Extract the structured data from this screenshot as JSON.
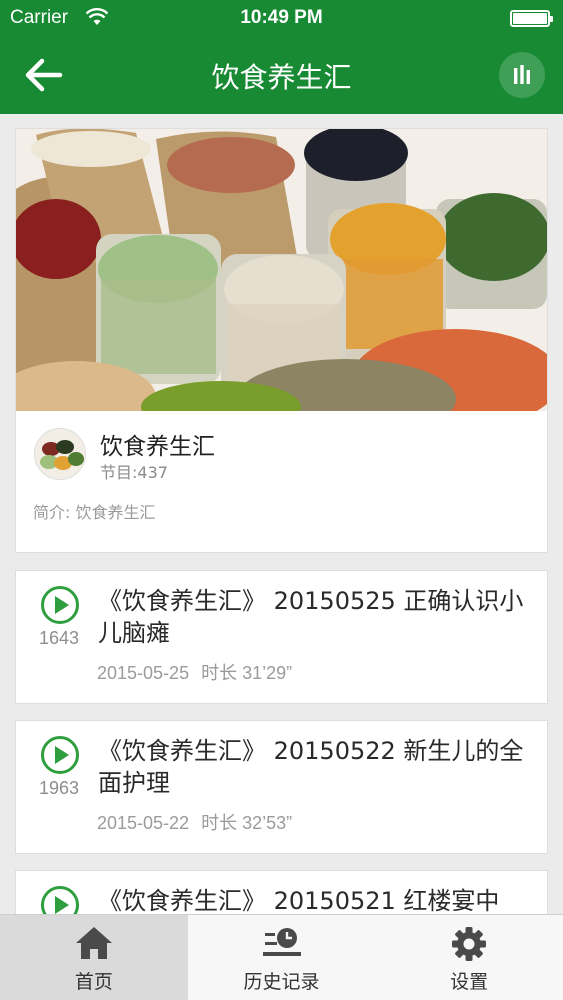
{
  "status_bar": {
    "carrier": "Carrier",
    "time": "10:49 PM"
  },
  "nav": {
    "title": "饮食养生汇"
  },
  "album": {
    "name": "饮食养生汇",
    "count": "节目:437",
    "intro": "简介:  饮食养生汇"
  },
  "episodes": [
    {
      "title": "《饮食养生汇》 20150525 正确认识小儿脑瘫",
      "plays": "1643",
      "date": "2015-05-25",
      "duration": "时长 31’29”"
    },
    {
      "title": "《饮食养生汇》 20150522 新生儿的全面护理",
      "plays": "1963",
      "date": "2015-05-22",
      "duration": "时长 32’53”"
    },
    {
      "title": "《饮食养生汇》 20150521 红楼宴中",
      "plays": "",
      "date": "",
      "duration": ""
    }
  ],
  "tabs": [
    {
      "label": "首页",
      "icon": "home-icon",
      "active": true
    },
    {
      "label": "历史记录",
      "icon": "history-icon",
      "active": false
    },
    {
      "label": "设置",
      "icon": "gear-icon",
      "active": false
    }
  ],
  "colors": {
    "header": "#178a33",
    "play": "#2f9e3f",
    "background": "#ebebeb"
  }
}
